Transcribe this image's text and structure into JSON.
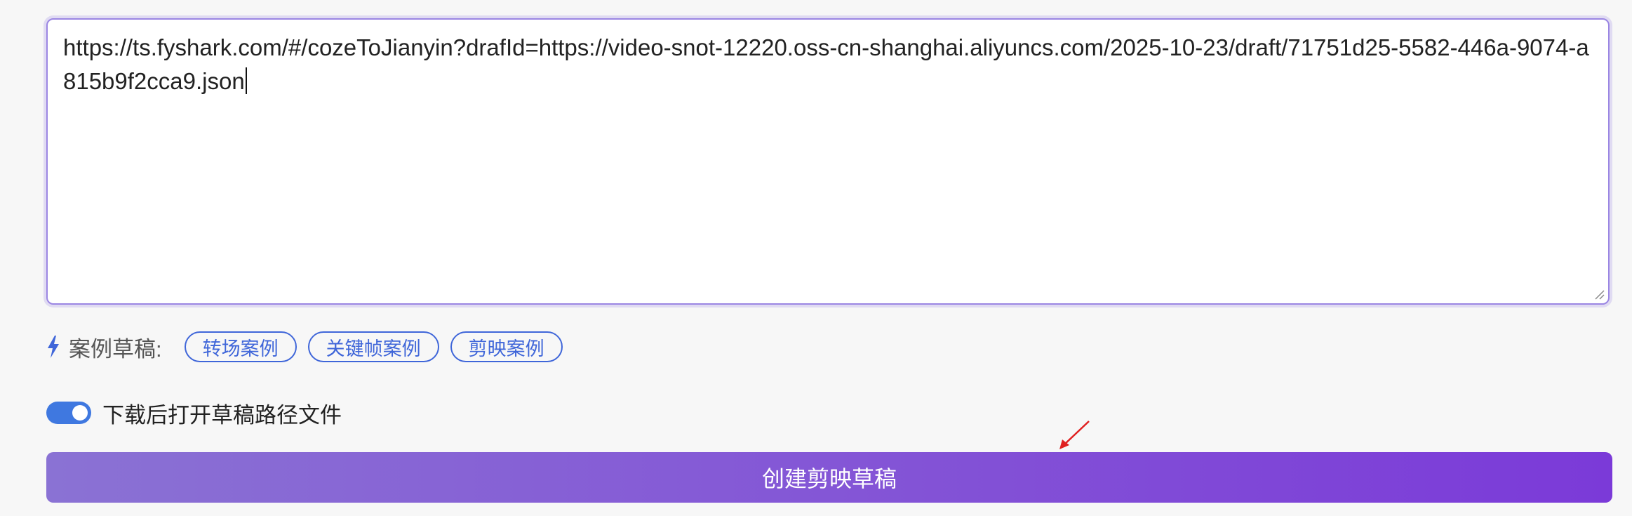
{
  "url_input": {
    "value": "https://ts.fyshark.com/#/cozeToJianyin?drafId=https://video-snot-12220.oss-cn-shanghai.aliyuncs.com/2025-10-23/draft/71751d25-5582-446a-9074-a815b9f2cca9.json"
  },
  "samples": {
    "icon": "bolt-icon",
    "label": "案例草稿:",
    "items": [
      "转场案例",
      "关键帧案例",
      "剪映案例"
    ]
  },
  "open_after_download": {
    "label": "下载后打开草稿路径文件",
    "enabled": true
  },
  "create_button": {
    "label": "创建剪映草稿"
  },
  "colors": {
    "accent_blue": "#3f66d9",
    "toggle_blue": "#3f78e0",
    "border_purple": "#9b86e3",
    "button_gradient_start": "#8a72d4",
    "button_gradient_end": "#7b3ad8",
    "annotation_arrow": "#e02020"
  }
}
